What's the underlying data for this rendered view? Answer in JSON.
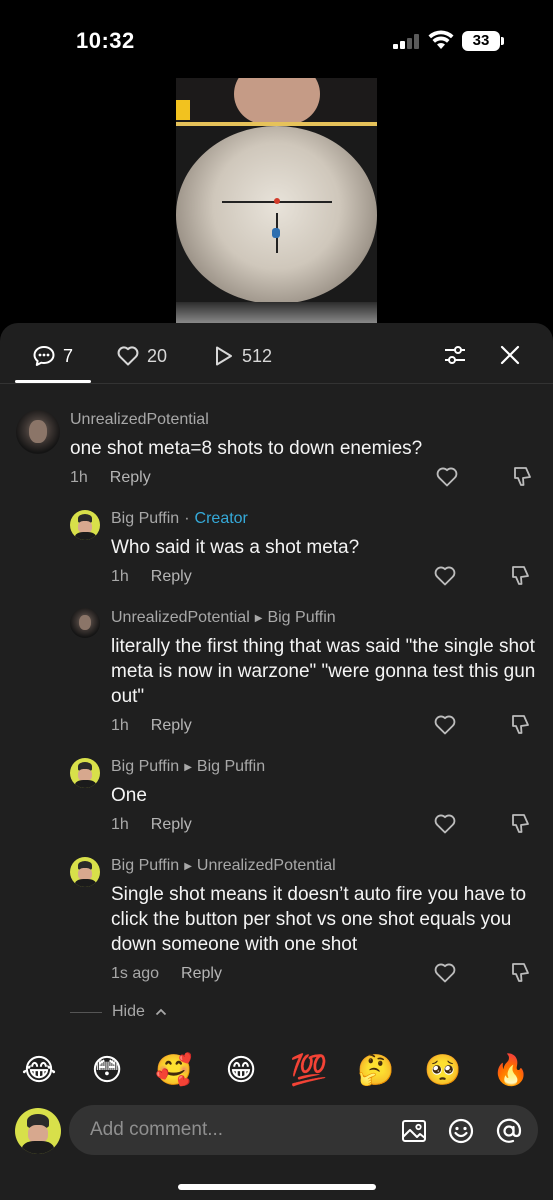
{
  "status_bar": {
    "time": "10:32",
    "battery": "33"
  },
  "tabs": {
    "comments_count": "7",
    "likes_count": "20",
    "views_count": "512"
  },
  "comments": [
    {
      "username": "UnrealizedPotential",
      "text": "one shot meta=8 shots to down enemies?",
      "time": "1h",
      "reply_label": "Reply"
    },
    {
      "username": "Big Puffin",
      "separator": "·",
      "badge": "Creator",
      "text": "Who said it was a shot meta?",
      "time": "1h",
      "reply_label": "Reply"
    },
    {
      "username": "UnrealizedPotential",
      "reply_to": "Big Puffin",
      "text": "literally the first thing that was said \"the single shot meta is now in warzone\" \"were gonna test this gun out\"",
      "time": "1h",
      "reply_label": "Reply"
    },
    {
      "username": "Big Puffin",
      "reply_to": "Big Puffin",
      "text": "One",
      "time": "1h",
      "reply_label": "Reply"
    },
    {
      "username": "Big Puffin",
      "reply_to": "UnrealizedPotential",
      "text": "Single shot means it doesn’t auto fire you have to click the button per shot vs one shot equals you down someone with one shot",
      "time": "1s ago",
      "reply_label": "Reply"
    }
  ],
  "hide_label": "Hide",
  "emojis": [
    "😂",
    "😳",
    "🥰",
    "😁",
    "💯",
    "🤔",
    "🥺",
    "🔥"
  ],
  "input": {
    "placeholder": "Add comment..."
  }
}
